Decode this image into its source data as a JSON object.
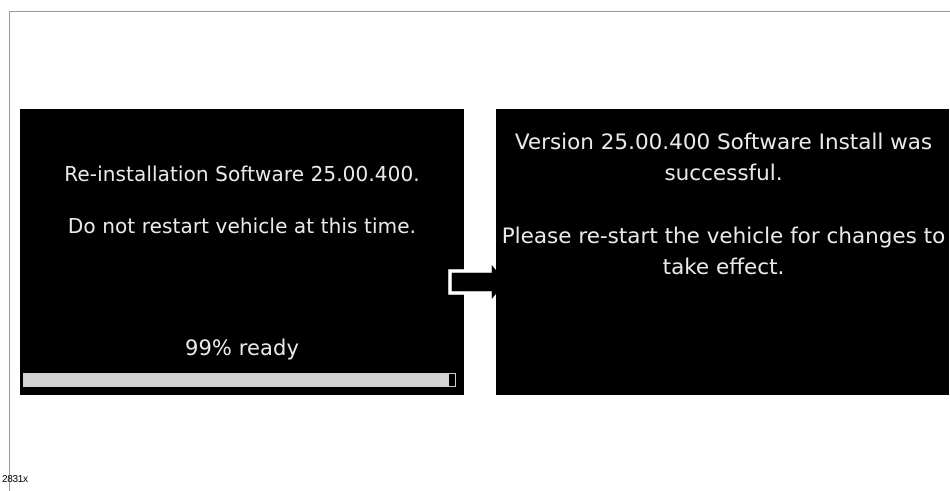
{
  "left_screen": {
    "line1": "Re-installation Software 25.00.400.",
    "line2": "Do not restart vehicle at this time.",
    "progress_label": "99% ready",
    "progress_fraction": 0.985
  },
  "right_screen": {
    "message1": "Version 25.00.400 Software Install was successful.",
    "message2": "Please re-start the vehicle for changes to take effect."
  },
  "transition_icon": "right-arrow-icon",
  "figure_id": "2831x",
  "colors": {
    "screen_bg": "#000000",
    "screen_text": "#e9e9e9",
    "progress_fill": "#d4d4d4"
  }
}
